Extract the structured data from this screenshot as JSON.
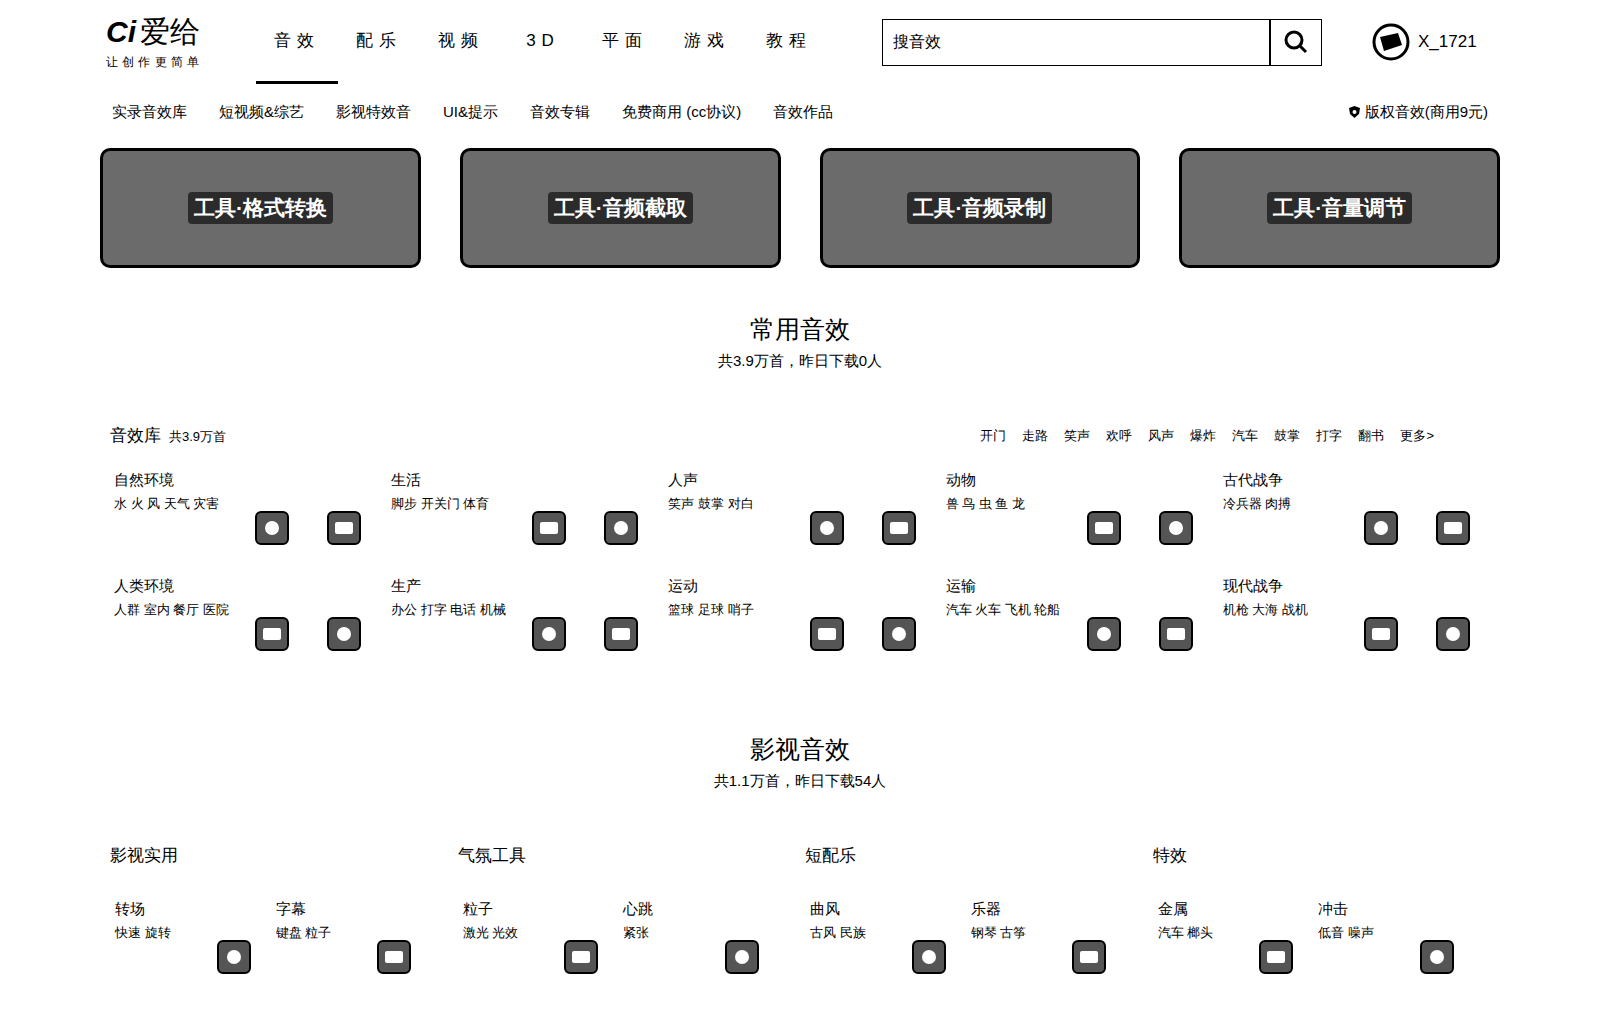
{
  "logo": {
    "mark": "Ci",
    "name": "爱给",
    "slogan": "让创作更简单"
  },
  "nav": [
    {
      "label": "音效",
      "selected": true
    },
    {
      "label": "配乐",
      "selected": false
    },
    {
      "label": "视频",
      "selected": false
    },
    {
      "label": "3D",
      "selected": false
    },
    {
      "label": "平面",
      "selected": false
    },
    {
      "label": "游戏",
      "selected": false
    },
    {
      "label": "教程",
      "selected": false
    }
  ],
  "search": {
    "placeholder": "搜音效"
  },
  "user": {
    "name": "X_1721"
  },
  "subnav": [
    "实录音效库",
    "短视频&综艺",
    "影视特效音",
    "UI&提示",
    "音效专辑",
    "免费商用 (cc协议)",
    "音效作品"
  ],
  "copyright_link": "版权音效(商用9元)",
  "tools": [
    "工具·格式转换",
    "工具·音频截取",
    "工具·音频录制",
    "工具·音量调节"
  ],
  "common": {
    "title": "常用音效",
    "subtitle": "共3.9万首，昨日下载0人",
    "library": {
      "title": "音效库",
      "count": "共3.9万首",
      "tags": [
        "开门",
        "走路",
        "笑声",
        "欢呼",
        "风声",
        "爆炸",
        "汽车",
        "鼓掌",
        "打字",
        "翻书",
        "更多>"
      ]
    },
    "categories": [
      {
        "title": "自然环境",
        "tags": "水 火 风 天气 灾害"
      },
      {
        "title": "生活",
        "tags": "脚步 开关门 体育"
      },
      {
        "title": "人声",
        "tags": "笑声 鼓掌 对白"
      },
      {
        "title": "动物",
        "tags": "兽 鸟 虫 鱼 龙"
      },
      {
        "title": "古代战争",
        "tags": "冷兵器 肉搏"
      },
      {
        "title": "人类环境",
        "tags": "人群 室内 餐厅 医院"
      },
      {
        "title": "生产",
        "tags": "办公 打字 电话 机械"
      },
      {
        "title": "运动",
        "tags": "篮球 足球 哨子"
      },
      {
        "title": "运输",
        "tags": "汽车 火车 飞机 轮船"
      },
      {
        "title": "现代战争",
        "tags": "机枪 大海 战机"
      }
    ]
  },
  "film": {
    "title": "影视音效",
    "subtitle": "共1.1万首，昨日下载54人",
    "groups": [
      {
        "title": "影视实用",
        "items": [
          {
            "title": "转场",
            "tags": "快速 旋转"
          },
          {
            "title": "字幕",
            "tags": "键盘 粒子"
          }
        ]
      },
      {
        "title": "气氛工具",
        "items": [
          {
            "title": "粒子",
            "tags": "激光 光效"
          },
          {
            "title": "心跳",
            "tags": "紧张"
          }
        ]
      },
      {
        "title": "短配乐",
        "items": [
          {
            "title": "曲风",
            "tags": "古风 民族"
          },
          {
            "title": "乐器",
            "tags": "钢琴 古筝"
          }
        ]
      },
      {
        "title": "特效",
        "items": [
          {
            "title": "金属",
            "tags": "汽车 榔头"
          },
          {
            "title": "冲击",
            "tags": "低音 噪声"
          }
        ]
      }
    ]
  }
}
